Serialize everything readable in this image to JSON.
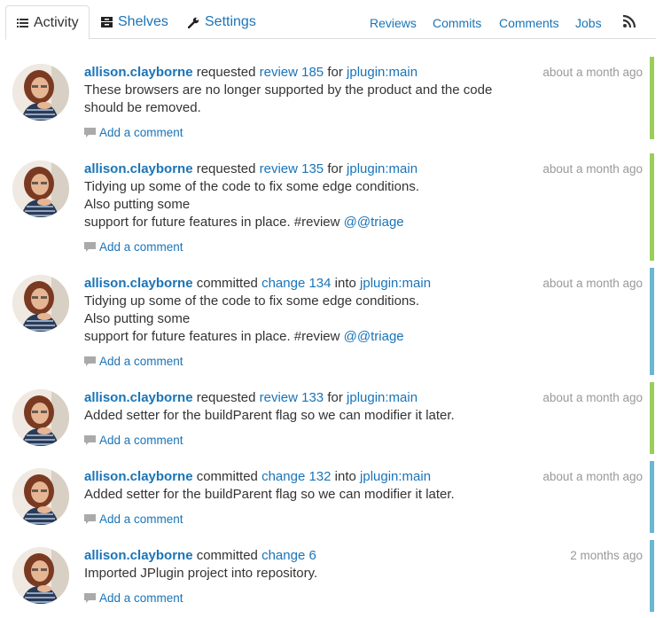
{
  "nav": {
    "tabs": [
      {
        "label": "Activity",
        "active": true,
        "icon": "list-icon"
      },
      {
        "label": "Shelves",
        "icon": "archive-icon"
      },
      {
        "label": "Settings",
        "icon": "wrench-icon"
      }
    ],
    "links": [
      "Reviews",
      "Commits",
      "Comments",
      "Jobs"
    ],
    "rss_icon": "rss-icon"
  },
  "colors": {
    "link": "#1a74b8",
    "review_bar": "#9ccd5b",
    "commit_bar": "#6ab7d3",
    "muted": "#999999"
  },
  "feed": [
    {
      "user": "allison.clayborne",
      "verb": "requested",
      "target": "review 185",
      "prep": "for",
      "project": "jplugin:main",
      "time": "about a month ago",
      "kind": "review",
      "desc": [
        "These browsers are no longer supported by the product and the code",
        "should be removed."
      ],
      "mention": "",
      "comment": "Add a comment"
    },
    {
      "user": "allison.clayborne",
      "verb": "requested",
      "target": "review 135",
      "prep": "for",
      "project": "jplugin:main",
      "time": "about a month ago",
      "kind": "review",
      "desc": [
        "Tidying up some of the code to fix some edge conditions.",
        "Also putting some",
        "support for future features in place. #review"
      ],
      "mention": "@@triage",
      "comment": "Add a comment"
    },
    {
      "user": "allison.clayborne",
      "verb": "committed",
      "target": "change 134",
      "prep": "into",
      "project": "jplugin:main",
      "time": "about a month ago",
      "kind": "commit",
      "desc": [
        "Tidying up some of the code to fix some edge conditions.",
        "Also putting some",
        "support for future features in place. #review"
      ],
      "mention": "@@triage",
      "comment": "Add a comment"
    },
    {
      "user": "allison.clayborne",
      "verb": "requested",
      "target": "review 133",
      "prep": "for",
      "project": "jplugin:main",
      "time": "about a month ago",
      "kind": "review",
      "desc": [
        "Added setter for the buildParent flag so we can modifier it later."
      ],
      "mention": "",
      "comment": "Add a comment"
    },
    {
      "user": "allison.clayborne",
      "verb": "committed",
      "target": "change 132",
      "prep": "into",
      "project": "jplugin:main",
      "time": "about a month ago",
      "kind": "commit",
      "desc": [
        "Added setter for the buildParent flag so we can modifier it later."
      ],
      "mention": "",
      "comment": "Add a comment"
    },
    {
      "user": "allison.clayborne",
      "verb": "committed",
      "target": "change 6",
      "prep": "",
      "project": "",
      "time": "2 months ago",
      "kind": "commit",
      "desc": [
        "Imported JPlugin project into repository."
      ],
      "mention": "",
      "comment": "Add a comment"
    }
  ]
}
